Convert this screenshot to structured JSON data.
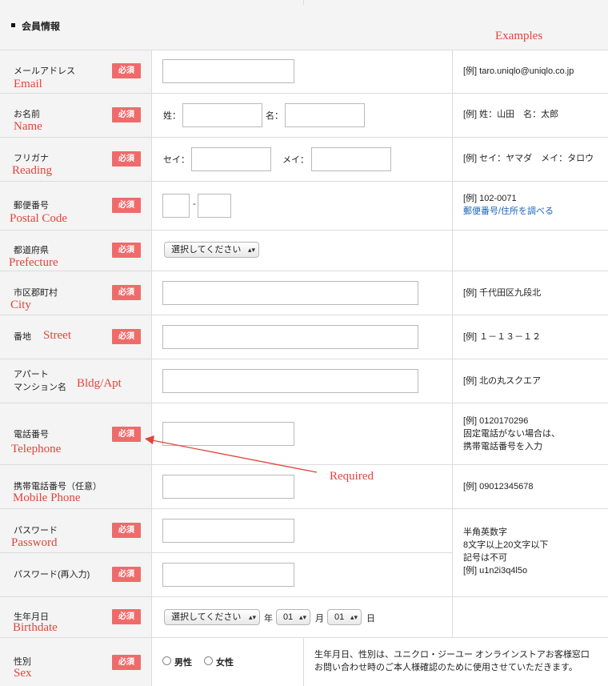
{
  "section": {
    "title": "会員情報",
    "examples_label": "Examples"
  },
  "required_badge": "必須",
  "rows": {
    "email": {
      "label": "メールアドレス",
      "en": "Email",
      "example": "[例] taro.uniqlo@uniqlo.co.jp"
    },
    "name": {
      "label": "お名前",
      "en": "Name",
      "sei": "姓：",
      "mei": "名：",
      "example": "[例] 姓：山田　名：太郎"
    },
    "reading": {
      "label": "フリガナ",
      "en": "Reading",
      "sei": "セイ：",
      "mei": "メイ：",
      "example": "[例] セイ：ヤマダ　メイ：タロウ"
    },
    "postal": {
      "label": "郵便番号",
      "en": "Postal Code",
      "dash": "-",
      "example": "[例] 102-0071",
      "link": "郵便番号/住所を調べる"
    },
    "prefecture": {
      "label": "都道府県",
      "en": "Prefecture",
      "select": "選択してください"
    },
    "city": {
      "label": "市区郡町村",
      "en": "City",
      "example": "[例] 千代田区九段北"
    },
    "street": {
      "label": "番地",
      "en": "Street",
      "example": "[例] １－１３－１２"
    },
    "apt": {
      "label1": "アパート",
      "label2": "マンション名",
      "en": "Bldg/Apt",
      "example": "[例] 北の丸スクエア"
    },
    "phone": {
      "label": "電話番号",
      "en": "Telephone",
      "example1": "[例] 0120170296",
      "example2": "固定電話がない場合は、",
      "example3": "携帯電話番号を入力"
    },
    "mobile": {
      "label": "携帯電話番号（任意）",
      "en": "Mobile Phone",
      "example": "[例] 09012345678"
    },
    "password": {
      "label": "パスワード",
      "en": "Password",
      "confirm_label": "パスワード(再入力)",
      "example1": "半角英数字",
      "example2": "8文字以上20文字以下",
      "example3": "記号は不可",
      "example4": "[例] u1n2i3q4l5o"
    },
    "birthdate": {
      "label": "生年月日",
      "en": "Birthdate",
      "select": "選択してください",
      "year": "年",
      "month_value": "01",
      "month": "月",
      "day_value": "01",
      "day": "日"
    },
    "sex": {
      "label": "性別",
      "en": "Sex",
      "male": "男性",
      "female": "女性",
      "note1": "生年月日、性別は、ユニクロ・ジーユー オンラインストアお客様窓口",
      "note2": "お問い合わせ時のご本人様確認のために使用させていただきます。"
    }
  },
  "annotation": {
    "required": "Required"
  },
  "colors": {
    "badge": "#ef6b6b",
    "annotation": "#e0453a",
    "link": "#1a63b8"
  }
}
